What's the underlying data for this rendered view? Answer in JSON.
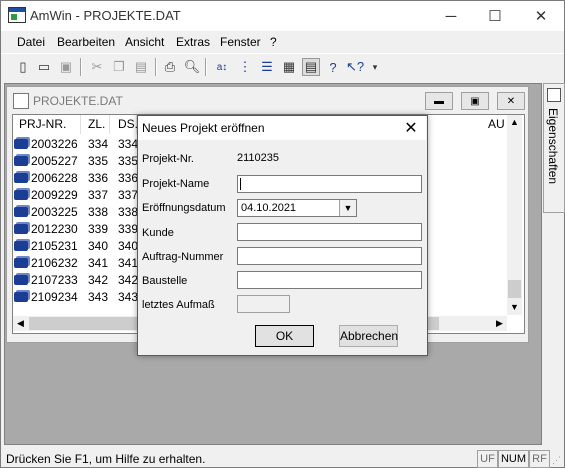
{
  "app": {
    "title": "AmWin - PROJEKTE.DAT"
  },
  "window_controls": {
    "minimize": "─",
    "maximize": "☐",
    "close": "✕"
  },
  "menu": [
    "Datei",
    "Bearbeiten",
    "Ansicht",
    "Extras",
    "Fenster",
    "?"
  ],
  "toolbar": {
    "icons": [
      "new-file-icon",
      "open-folder-icon",
      "save-icon",
      "cut-icon",
      "copy-icon",
      "paste-icon",
      "print-icon",
      "print-preview-icon",
      "sort-icon",
      "tree-icon",
      "outline-icon",
      "list-view-icon",
      "detail-view-icon",
      "help-icon",
      "context-help-icon",
      "dropdown-icon"
    ]
  },
  "child_window": {
    "title": "PROJEKTE.DAT",
    "columns": [
      "PRJ-NR.",
      "ZL.",
      "DS.",
      "AU"
    ],
    "rows": [
      {
        "nr": "2003226",
        "zl": "334",
        "ds": "334"
      },
      {
        "nr": "2005227",
        "zl": "335",
        "ds": "335"
      },
      {
        "nr": "2006228",
        "zl": "336",
        "ds": "336"
      },
      {
        "nr": "2009229",
        "zl": "337",
        "ds": "337"
      },
      {
        "nr": "2003225",
        "zl": "338",
        "ds": "338"
      },
      {
        "nr": "2012230",
        "zl": "339",
        "ds": "339"
      },
      {
        "nr": "2105231",
        "zl": "340",
        "ds": "340"
      },
      {
        "nr": "2106232",
        "zl": "341",
        "ds": "341"
      },
      {
        "nr": "2107233",
        "zl": "342",
        "ds": "342"
      },
      {
        "nr": "2109234",
        "zl": "343",
        "ds": "343"
      }
    ]
  },
  "side_panel": {
    "label": "Eigenschaften"
  },
  "dialog": {
    "title": "Neues Projekt eröffnen",
    "fields": {
      "projekt_nr_label": "Projekt-Nr.",
      "projekt_nr_value": "2110235",
      "projekt_name_label": "Projekt-Name",
      "projekt_name_value": "",
      "eroeffnungsdatum_label": "Eröffnungsdatum",
      "eroeffnungsdatum_value": "04.10.2021",
      "kunde_label": "Kunde",
      "kunde_value": "",
      "auftrag_label": "Auftrag-Nummer",
      "auftrag_value": "",
      "baustelle_label": "Baustelle",
      "baustelle_value": "",
      "aufmass_label": "letztes Aufmaß",
      "aufmass_value": ""
    },
    "ok_label": "OK",
    "cancel_label": "Abbrechen"
  },
  "status": {
    "text": "Drücken Sie F1, um Hilfe zu erhalten.",
    "indicators": [
      "UF",
      "NUM",
      "RF"
    ]
  }
}
